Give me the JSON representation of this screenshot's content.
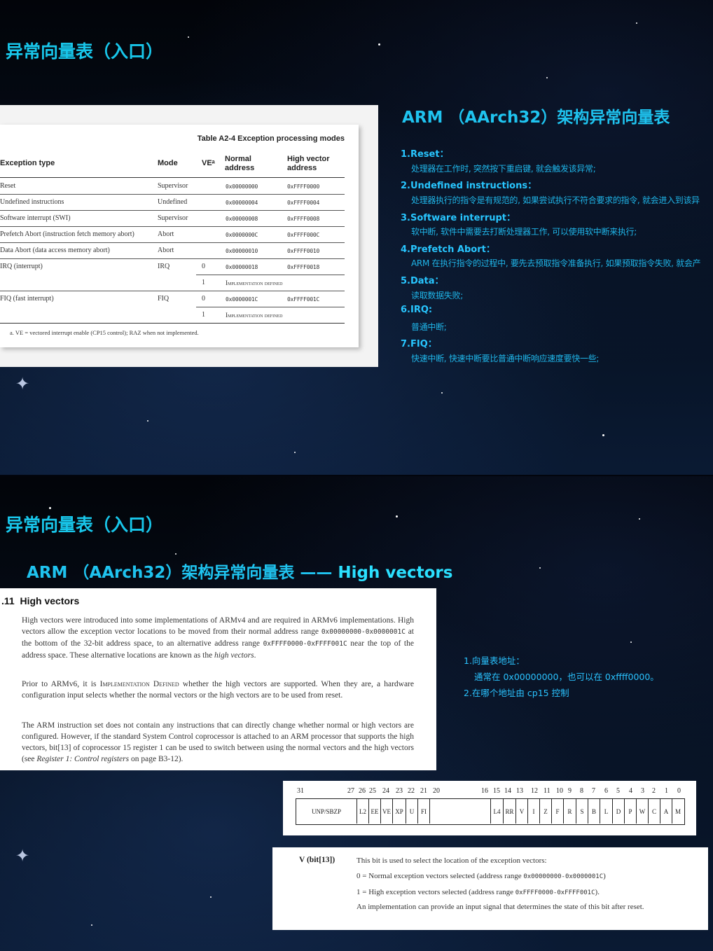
{
  "slide1": {
    "title": "异常向量表（入口）",
    "subtitle": "ARM （AArch32）架构异常向量表",
    "table": {
      "caption": "Table A2-4 Exception processing modes",
      "headers": {
        "type": "Exception type",
        "mode": "Mode",
        "ve": "VEᵃ",
        "normal_1": "Normal",
        "normal_2": "address",
        "high_1": "High vector",
        "high_2": "address"
      },
      "rows": [
        {
          "type": "Reset",
          "mode": "Supervisor",
          "ve": "",
          "normal": "0x00000000",
          "high": "0xFFFF0000"
        },
        {
          "type": "Undefined instructions",
          "mode": "Undefined",
          "ve": "",
          "normal": "0x00000004",
          "high": "0xFFFF0004"
        },
        {
          "type": "Software interrupt (SWI)",
          "mode": "Supervisor",
          "ve": "",
          "normal": "0x00000008",
          "high": "0xFFFF0008"
        },
        {
          "type": "Prefetch Abort (instruction fetch memory abort)",
          "mode": "Abort",
          "ve": "",
          "normal": "0x0000000C",
          "high": "0xFFFF000C"
        },
        {
          "type": "Data Abort (data access memory abort)",
          "mode": "Abort",
          "ve": "",
          "normal": "0x00000010",
          "high": "0xFFFF0010"
        },
        {
          "type": "IRQ (interrupt)",
          "mode": "IRQ",
          "ve": "0",
          "normal": "0x00000018",
          "high": "0xFFFF0018"
        },
        {
          "type": "",
          "mode": "",
          "ve": "1",
          "normal": "Implementation defined",
          "high": ""
        },
        {
          "type": "FIQ (fast interrupt)",
          "mode": "FIQ",
          "ve": "0",
          "normal": "0x0000001C",
          "high": "0xFFFF001C"
        },
        {
          "type": "",
          "mode": "",
          "ve": "1",
          "normal": "Implementation defined",
          "high": ""
        }
      ],
      "footnote": "a.   VE = vectored interrupt enable (CP15 control); RAZ when not implemented."
    },
    "exceptions": [
      {
        "head": "1.Reset：",
        "desc": "处理器在工作时, 突然按下重启键, 就会触发该异常;"
      },
      {
        "head": "2.Undefined instructions：",
        "desc": "处理器执行的指令是有规范的, 如果尝试执行不符合要求的指令, 就会进入到该异"
      },
      {
        "head": "3.Software interrupt：",
        "desc": "软中断, 软件中需要去打断处理器工作, 可以使用软中断来执行;"
      },
      {
        "head": "4.Prefetch Abort：",
        "desc": "ARM 在执行指令的过程中, 要先去预取指令准备执行, 如果预取指令失败, 就会产"
      },
      {
        "head": "5.Data：",
        "desc": "读取数据失败;"
      },
      {
        "head": "6.IRQ:",
        "desc": "普通中断;"
      },
      {
        "head": "7.FIQ：",
        "desc": "快速中断, 快速中断要比普通中断响应速度要快一些;"
      }
    ]
  },
  "slide2": {
    "title": "异常向量表（入口）",
    "subtitle_a": "ARM （AArch32）架构异常向量表 —— ",
    "subtitle_b": "High vectors",
    "section": {
      "number": ".11",
      "heading": "High vectors",
      "p1_a": "High vectors were introduced into some implementations of ARMv4 and are required in ARMv6 implementations. High vectors allow the exception vector locations to be moved from their normal address range ",
      "p1_code1": "0x00000000-0x0000001C",
      "p1_b": " at the bottom of the 32-bit address space, to an alternative address range ",
      "p1_code2": "0xFFFF0000-0xFFFF001C",
      "p1_c": " near the top of the address space. These alternative locations are known as the ",
      "p1_em": "high vectors",
      "p1_d": ".",
      "p2_a": "Prior to ARMv6, it is ",
      "p2_sc": "Implementation Defined",
      "p2_b": " whether the high vectors are supported. When they are, a hardware configuration input selects whether the normal vectors or the high vectors are to be used from reset.",
      "p3_a": "The ARM instruction set does not contain any instructions that can directly change whether normal or high vectors are configured. However, if the standard System Control coprocessor is attached to an ARM processor that supports the high vectors, bit[13] of coprocessor 15 register 1 can be used to switch between using the normal vectors and the high vectors (see ",
      "p3_em": "Register 1: Control registers",
      "p3_b": " on page B3-12)."
    },
    "notes": [
      {
        "head": "1.向量表地址：",
        "desc": "通常在 0x00000000，也可以在 0xffff0000。"
      },
      {
        "head": "2.在哪个地址由 cp15 控制",
        "desc": ""
      }
    ],
    "register": {
      "bit_numbers": [
        "31",
        "27",
        "26",
        "25",
        "24",
        "23",
        "22",
        "21",
        "20",
        "16",
        "15",
        "14",
        "13",
        "12",
        "11",
        "10",
        "9",
        "8",
        "7",
        "6",
        "5",
        "4",
        "3",
        "2",
        "1",
        "0"
      ],
      "fields": [
        "UNP/SBZP",
        "L2",
        "EE",
        "VE",
        "XP",
        "U",
        "FI",
        "",
        "L4",
        "RR",
        "V",
        "I",
        "Z",
        "F",
        "R",
        "S",
        "B",
        "L",
        "D",
        "P",
        "W",
        "C",
        "A",
        "M"
      ]
    },
    "vbit": {
      "label": "V (bit[13])",
      "line1": "This bit is used to select the location of the exception vectors:",
      "line2_a": "0 = Normal exception vectors selected (address range ",
      "line2_code": "0x00000000-0x0000001C",
      "line2_b": ")",
      "line3_a": "1 = High exception vectors selected (address range ",
      "line3_code": "0xFFFF0000-0xFFFF001C",
      "line3_b": ").",
      "line4": "An implementation can provide an input signal that determines the state of this bit after reset."
    }
  }
}
